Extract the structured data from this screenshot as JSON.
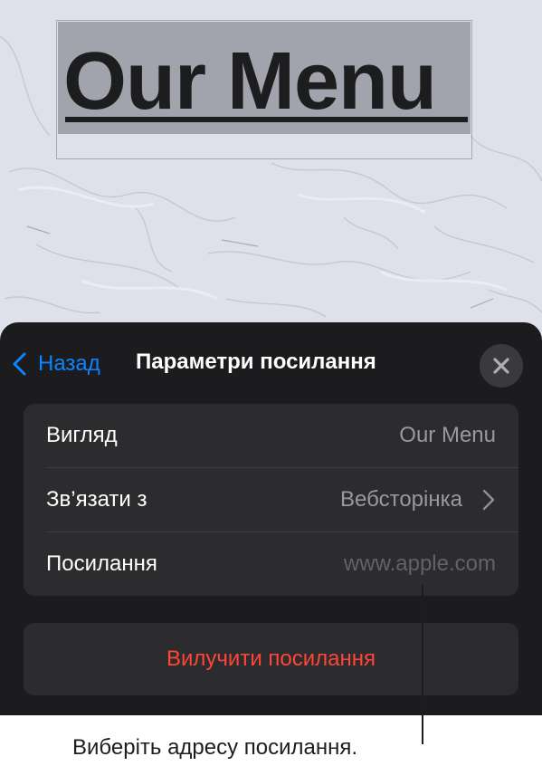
{
  "document": {
    "title": "Our Menu"
  },
  "popover": {
    "back_label": "Назад",
    "title": "Параметри посилання",
    "rows": [
      {
        "label": "Вигляд",
        "value": "Our Menu"
      },
      {
        "label": "Зв’язати з",
        "value": "Вебсторінка"
      },
      {
        "label": "Посилання",
        "value": "www.apple.com"
      }
    ],
    "remove_label": "Вилучити посилання"
  },
  "callout": {
    "text": "Виберіть адресу посилання."
  },
  "colors": {
    "accent": "#0a84ff",
    "destructive": "#ff453a",
    "panel_background": "#1c1c1e",
    "group_background": "#2c2c2e"
  },
  "icons": {
    "back": "chevron-left-icon",
    "close": "close-icon",
    "disclosure": "chevron-right-icon"
  }
}
